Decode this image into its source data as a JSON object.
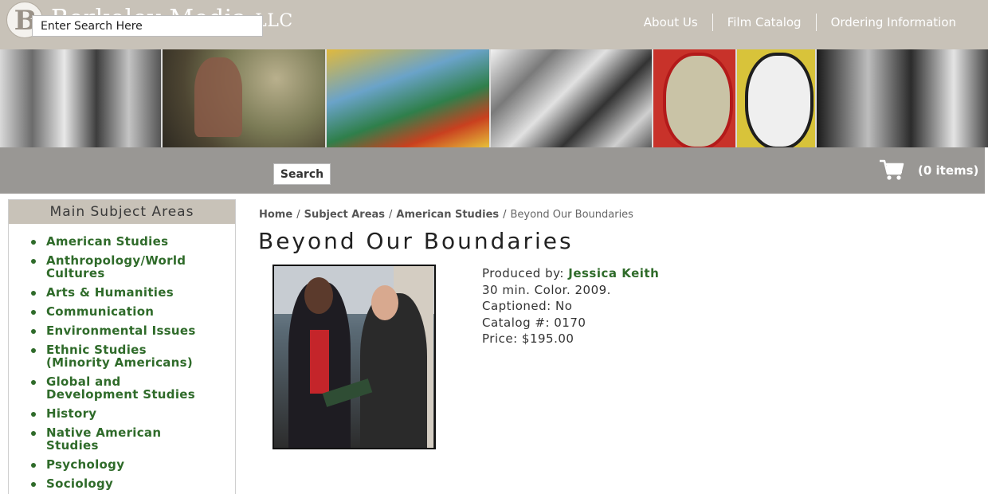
{
  "brand": {
    "initial": "B",
    "name": "Berkeley Media",
    "suffix": "LLC"
  },
  "nav": [
    {
      "label": "About Us"
    },
    {
      "label": "Film Catalog"
    },
    {
      "label": "Ordering Information"
    }
  ],
  "search": {
    "placeholder": "Enter Search Here",
    "button_label": "Search"
  },
  "cart": {
    "count_label": "(0 items)",
    "icon": "cart-icon"
  },
  "sidebar": {
    "heading": "Main Subject Areas",
    "items": [
      {
        "label": "American Studies"
      },
      {
        "label": "Anthropology/World Cultures"
      },
      {
        "label": "Arts & Humanities"
      },
      {
        "label": "Communication"
      },
      {
        "label": "Environmental Issues"
      },
      {
        "label": "Ethnic Studies (Minority Americans)"
      },
      {
        "label": "Global and Development Studies"
      },
      {
        "label": "History"
      },
      {
        "label": "Native American Studies"
      },
      {
        "label": "Psychology"
      },
      {
        "label": "Sociology"
      }
    ]
  },
  "breadcrumb": {
    "items": [
      {
        "label": "Home"
      },
      {
        "label": "Subject Areas"
      },
      {
        "label": "American Studies"
      }
    ],
    "current": "Beyond Our Boundaries",
    "separator": "/"
  },
  "film": {
    "title": "Beyond Our Boundaries",
    "produced_by_label": "Produced by:",
    "producer": "Jessica Keith",
    "info": "30 min. Color. 2009.",
    "captioned": "Captioned: No",
    "catalog": "Catalog #: 0170",
    "price": "Price: $195.00"
  },
  "colors": {
    "header_bg": "#c8c2b8",
    "search_bar_bg": "#999794",
    "link_green": "#2f6b2a"
  }
}
